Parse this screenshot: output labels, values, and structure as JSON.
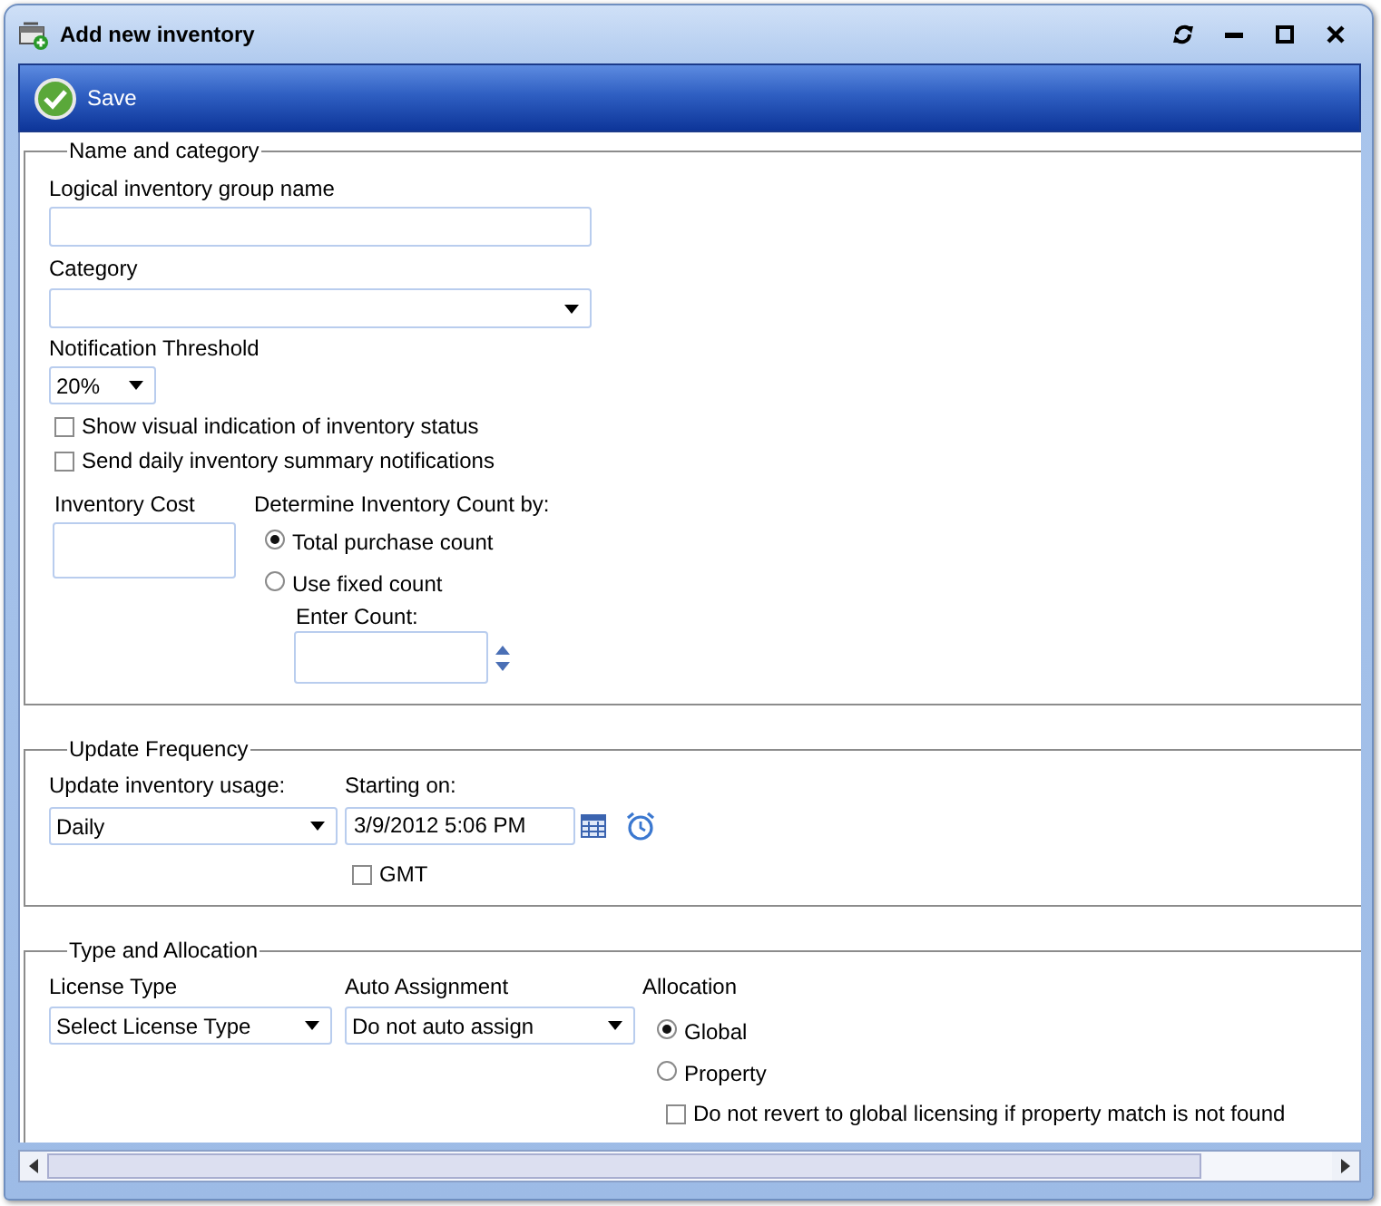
{
  "window": {
    "title": "Add new inventory"
  },
  "toolbar": {
    "save_label": "Save"
  },
  "name_and_category": {
    "legend": "Name and category",
    "group_name": {
      "label": "Logical inventory group name"
    },
    "category": {
      "label": "Category"
    },
    "notification_threshold": {
      "label": "Notification Threshold",
      "value": "20%"
    },
    "options": [
      {
        "label": "Show visual indication of inventory status",
        "checked": false
      },
      {
        "label": "Send daily inventory summary notifications",
        "checked": false
      }
    ],
    "inventory_cost": {
      "label": "Inventory Cost"
    },
    "count_method": {
      "label": "Determine Inventory Count by:",
      "choices": [
        {
          "label": "Total purchase count",
          "selected": true
        },
        {
          "label": "Use fixed count",
          "selected": false
        }
      ]
    },
    "enter_count": {
      "label": "Enter Count:"
    }
  },
  "update_frequency": {
    "legend": "Update Frequency",
    "usage": {
      "label": "Update inventory usage:",
      "value": "Daily"
    },
    "starting_on": {
      "label": "Starting on:",
      "value": "3/9/2012 5:06 PM"
    },
    "gmt": {
      "label": "GMT",
      "checked": false
    }
  },
  "type_and_allocation": {
    "legend": "Type and Allocation",
    "license_type": {
      "label": "License Type",
      "value": "Select License Type"
    },
    "auto_assignment": {
      "label": "Auto Assignment",
      "value": "Do not auto assign"
    },
    "allocation": {
      "label": "Allocation",
      "choices": [
        {
          "label": "Global",
          "selected": true
        },
        {
          "label": "Property",
          "selected": false
        }
      ]
    },
    "no_revert": {
      "label": "Do not revert to global licensing if property match is not found",
      "checked": false
    }
  }
}
